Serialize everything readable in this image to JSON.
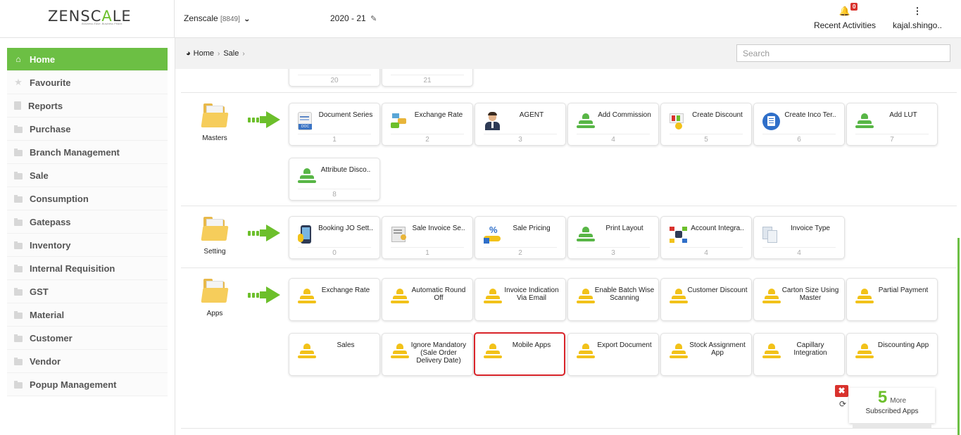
{
  "header": {
    "logo_text_1": "ZENSC",
    "logo_text_accent": "A",
    "logo_text_2": "LE",
    "logo_tagline": "Business Ease. Business Peace.",
    "company": "Zenscale",
    "company_code": "[8849]",
    "financial_year": "2020 - 21",
    "notification_count": "0",
    "recent_label": "Recent Activities",
    "user_label": "kajal.shingo.."
  },
  "sidebar": {
    "items": [
      {
        "label": "Home",
        "icon": "home-icon"
      },
      {
        "label": "Favourite",
        "icon": "star-icon"
      },
      {
        "label": "Reports",
        "icon": "file-icon"
      },
      {
        "label": "Purchase",
        "icon": "folder-icon"
      },
      {
        "label": "Branch Management",
        "icon": "folder-icon"
      },
      {
        "label": "Sale",
        "icon": "folder-icon"
      },
      {
        "label": "Consumption",
        "icon": "folder-icon"
      },
      {
        "label": "Gatepass",
        "icon": "folder-icon"
      },
      {
        "label": "Inventory",
        "icon": "folder-icon"
      },
      {
        "label": "Internal Requisition",
        "icon": "folder-icon"
      },
      {
        "label": "GST",
        "icon": "folder-icon"
      },
      {
        "label": "Material",
        "icon": "folder-icon"
      },
      {
        "label": "Customer",
        "icon": "folder-icon"
      },
      {
        "label": "Vendor",
        "icon": "folder-icon"
      },
      {
        "label": "Popup Management",
        "icon": "folder-icon"
      }
    ]
  },
  "breadcrumb": {
    "home": "Home",
    "current": "Sale"
  },
  "search": {
    "placeholder": "Search"
  },
  "sections": {
    "top_partial": {
      "tiles": [
        {
          "num": "20"
        },
        {
          "num": "21"
        }
      ]
    },
    "masters": {
      "label": "Masters",
      "tiles": [
        {
          "name": "Document Series",
          "num": "1"
        },
        {
          "name": "Exchange Rate",
          "num": "2"
        },
        {
          "name": "AGENT",
          "num": "3"
        },
        {
          "name": "Add Commission",
          "num": "4"
        },
        {
          "name": "Create Discount",
          "num": "5"
        },
        {
          "name": "Create Inco Ter..",
          "num": "6"
        },
        {
          "name": "Add LUT",
          "num": "7"
        },
        {
          "name": "Attribute Disco..",
          "num": "8"
        }
      ]
    },
    "setting": {
      "label": "Setting",
      "tiles": [
        {
          "name": "Booking JO Sett..",
          "num": "0"
        },
        {
          "name": "Sale Invoice Se..",
          "num": "1"
        },
        {
          "name": "Sale Pricing",
          "num": "2"
        },
        {
          "name": "Print Layout",
          "num": "3"
        },
        {
          "name": "Account Integra..",
          "num": "4"
        },
        {
          "name": "Invoice Type",
          "num": "4"
        }
      ]
    },
    "apps": {
      "label": "Apps",
      "tiles": [
        {
          "name": "Exchange Rate"
        },
        {
          "name": "Automatic Round Off"
        },
        {
          "name": "Invoice Indication Via Email"
        },
        {
          "name": "Enable Batch Wise Scanning"
        },
        {
          "name": "Customer Discount"
        },
        {
          "name": "Carton Size Using Master"
        },
        {
          "name": "Partial Payment"
        },
        {
          "name": "Sales"
        },
        {
          "name": "Ignore Mandatory (Sale Order Delivery Date)"
        },
        {
          "name": "Mobile Apps"
        },
        {
          "name": "Export Document"
        },
        {
          "name": "Stock Assignment App"
        },
        {
          "name": "Capillary Integration"
        },
        {
          "name": "Discounting App"
        }
      ]
    }
  },
  "subscribed": {
    "count": "5",
    "more_label": "More",
    "label": "Subscribed Apps"
  },
  "colors": {
    "accent_green": "#6cbf44",
    "selected_border": "#d9242a",
    "badge_red": "#d9322d",
    "app_icon_yellow": "#f2c21a"
  }
}
